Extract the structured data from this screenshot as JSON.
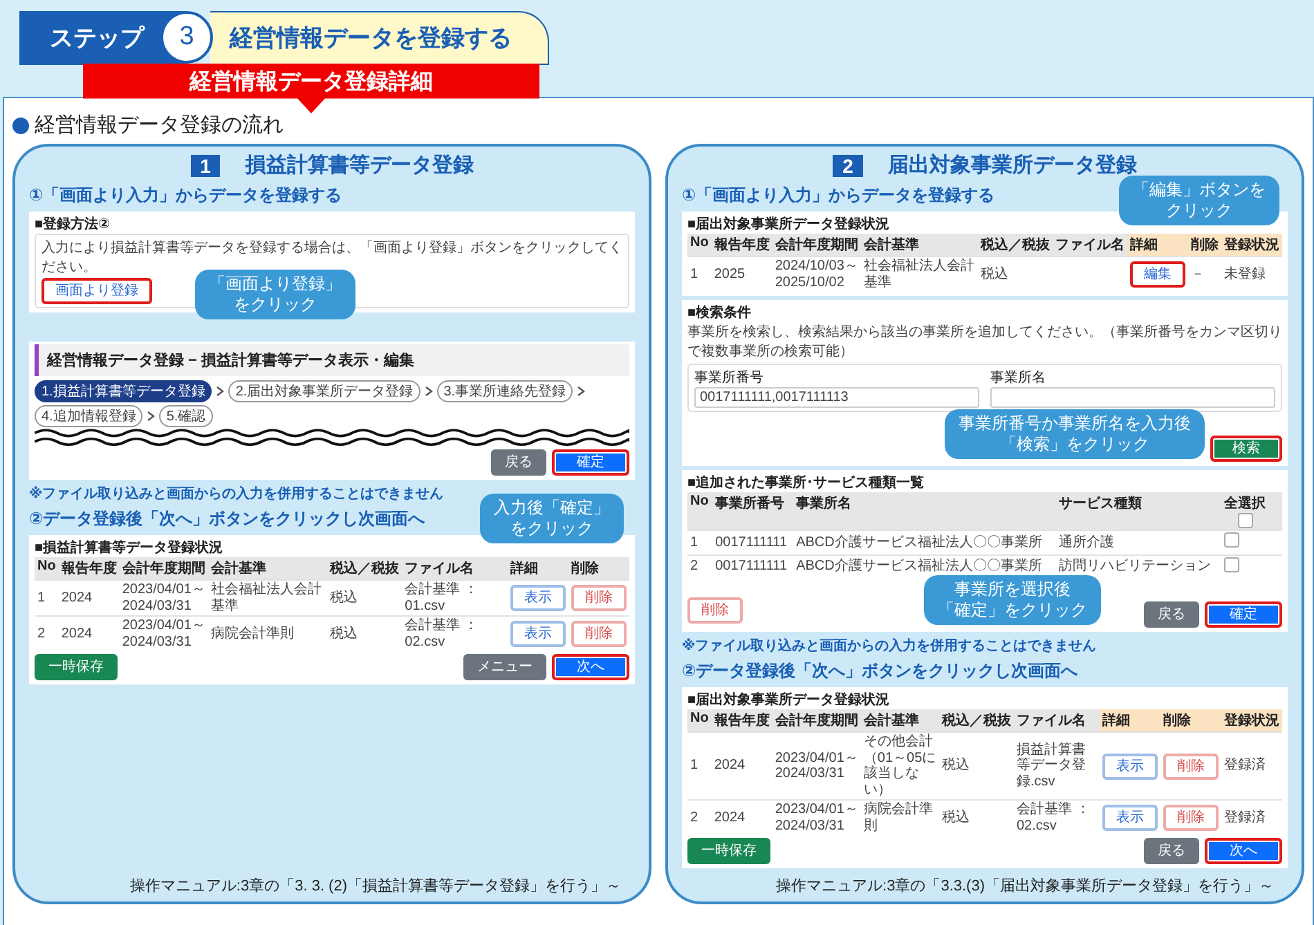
{
  "header": {
    "step_label": "ステップ",
    "step_number": "3",
    "step_title": "経営情報データを登録する",
    "banner": "経営情報データ登録詳細"
  },
  "section_title": "経営情報データ登録の流れ",
  "panels": [
    {
      "number": "1",
      "title": "損益計算書等データ登録",
      "step1_heading": "①「画面より入力」からデータを登録する",
      "blocks": [
        {
          "kind": "method",
          "caption": "■登録方法②",
          "text": "入力により損益計算書等データを登録する場合は、「画面より登録」ボタンをクリックしてください。",
          "button": {
            "label": "画面より登録",
            "kind": "outline",
            "highlight": true
          },
          "callout": [
            "「画面より登録」",
            "をクリック"
          ]
        },
        {
          "kind": "edit_screen",
          "title": "経営情報データ登録 − 損益計算書等データ表示・編集",
          "steps": [
            {
              "label": "1.損益計算書等データ登録",
              "selected": true
            },
            {
              "label": "2.届出対象事業所データ登録",
              "selected": false
            },
            {
              "label": "3.事業所連絡先登録",
              "selected": false
            },
            {
              "label": "4.追加情報登録",
              "selected": false
            },
            {
              "label": "5.確認",
              "selected": false
            }
          ],
          "actions": [
            {
              "label": "戻る",
              "kind": "back",
              "highlight": false
            },
            {
              "label": "確定",
              "kind": "primary",
              "highlight": true
            }
          ],
          "callout": [
            "入力後「確定」",
            "をクリック"
          ]
        }
      ],
      "note": "※ファイル取り込みと画面からの入力を併用することはできません",
      "step2_heading": "②データ登録後「次へ」ボタンをクリックし次画面へ",
      "table": {
        "caption": "■損益計算書等データ登録状況",
        "columns": [
          {
            "label": "No",
            "tinted": false
          },
          {
            "label": "報告年度",
            "tinted": false
          },
          {
            "label": "会計年度期間",
            "tinted": false
          },
          {
            "label": "会計基準",
            "tinted": false
          },
          {
            "label": "税込／税抜",
            "tinted": false
          },
          {
            "label": "ファイル名",
            "tinted": false
          },
          {
            "label": "詳細",
            "tinted": false
          },
          {
            "label": "削除",
            "tinted": false
          }
        ],
        "rows": [
          {
            "cells": [
              "1",
              "2024",
              "2023/04/01～\n2024/03/31",
              "社会福祉法人会計基準",
              "税込",
              "会計基準 ：01.csv",
              {
                "label": "表示",
                "kind": "view",
                "highlight": false
              },
              {
                "label": "削除",
                "kind": "danger",
                "highlight": false
              }
            ]
          },
          {
            "cells": [
              "2",
              "2024",
              "2023/04/01～\n2024/03/31",
              "病院会計準則",
              "税込",
              "会計基準 ：02.csv",
              {
                "label": "表示",
                "kind": "view",
                "highlight": false
              },
              {
                "label": "削除",
                "kind": "danger",
                "highlight": false
              }
            ]
          }
        ],
        "actions": [
          {
            "label": "一時保存",
            "kind": "save",
            "highlight": false
          },
          {
            "label": "メニュー",
            "kind": "back",
            "highlight": false
          },
          {
            "label": "次へ",
            "kind": "primary",
            "highlight": true
          }
        ]
      },
      "manual_ref": "操作マニュアル:3章の「3. 3. (2)「損益計算書等データ登録」を行う」～"
    },
    {
      "number": "2",
      "title": "届出対象事業所データ登録",
      "step1_heading": "①「画面より入力」からデータを登録する",
      "blocks": [
        {
          "kind": "status_table",
          "caption": "■届出対象事業所データ登録状況",
          "columns": [
            {
              "label": "No",
              "tinted": false
            },
            {
              "label": "報告年度",
              "tinted": false
            },
            {
              "label": "会計年度期間",
              "tinted": false
            },
            {
              "label": "会計基準",
              "tinted": false
            },
            {
              "label": "税込／税抜",
              "tinted": false
            },
            {
              "label": "ファイル名",
              "tinted": false
            },
            {
              "label": "詳細",
              "tinted": true
            },
            {
              "label": "削除",
              "tinted": true
            },
            {
              "label": "登録状況",
              "tinted": true
            }
          ],
          "rows": [
            {
              "cells": [
                "1",
                "2025",
                "2024/10/03～\n2025/10/02",
                "社会福祉法人会計基準",
                "税込",
                null,
                {
                  "label": "編集",
                  "kind": "edit",
                  "highlight": true
                },
                "－",
                "未登録"
              ]
            }
          ],
          "callout": [
            "「編集」ボタンを",
            "クリック"
          ]
        },
        {
          "kind": "search",
          "caption": "■検索条件",
          "text": "事業所を検索し、検索結果から該当の事業所を追加してください。（事業所番号をカンマ区切りで複数事業所の検索可能）",
          "fields": [
            {
              "label": "事業所番号",
              "value": "0017111111,0017111113"
            },
            {
              "label": "事業所名"
            }
          ],
          "button": {
            "label": "検索",
            "kind": "search",
            "highlight": true
          },
          "callout": [
            "事業所番号か事業所名を入力後",
            "「検索」をクリック"
          ]
        },
        {
          "kind": "added_list",
          "caption": "■追加された事業所･サービス種類一覧",
          "columns": [
            "No",
            "事業所番号",
            "事業所名",
            "サービス種類",
            "全選択"
          ],
          "select_all_checked": false,
          "rows": [
            {
              "cells": [
                "1",
                "0017111111",
                "ABCD介護サービス福祉法人〇〇事業所",
                "通所介護"
              ],
              "checked": false
            },
            {
              "cells": [
                "2",
                "0017111111",
                "ABCD介護サービス福祉法人〇〇事業所",
                "訪問リハビリテーション"
              ],
              "checked": false
            }
          ],
          "delete_button": {
            "label": "削除",
            "kind": "danger",
            "highlight": false
          },
          "actions": [
            {
              "label": "戻る",
              "kind": "back",
              "highlight": false
            },
            {
              "label": "確定",
              "kind": "primary",
              "highlight": true
            }
          ],
          "callout": [
            "事業所を選択後",
            "「確定」をクリック"
          ]
        }
      ],
      "note": "※ファイル取り込みと画面からの入力を併用することはできません",
      "step2_heading": "②データ登録後「次へ」ボタンをクリックし次画面へ",
      "table": {
        "caption": "■届出対象事業所データ登録状況",
        "columns": [
          {
            "label": "No",
            "tinted": false
          },
          {
            "label": "報告年度",
            "tinted": false
          },
          {
            "label": "会計年度期間",
            "tinted": false
          },
          {
            "label": "会計基準",
            "tinted": false
          },
          {
            "label": "税込／税抜",
            "tinted": false
          },
          {
            "label": "ファイル名",
            "tinted": false
          },
          {
            "label": "詳細",
            "tinted": true
          },
          {
            "label": "削除",
            "tinted": true
          },
          {
            "label": "登録状況",
            "tinted": true
          }
        ],
        "rows": [
          {
            "cells": [
              "1",
              "2024",
              "2023/04/01～\n2024/03/31",
              "その他会計（01～05に該当しない）",
              "税込",
              "損益計算書等データ登録.csv",
              {
                "label": "表示",
                "kind": "view",
                "highlight": false
              },
              {
                "label": "削除",
                "kind": "danger",
                "highlight": false
              },
              "登録済"
            ]
          },
          {
            "cells": [
              "2",
              "2024",
              "2023/04/01～\n2024/03/31",
              "病院会計準則",
              "税込",
              "会計基準 ：02.csv",
              {
                "label": "表示",
                "kind": "view",
                "highlight": false
              },
              {
                "label": "削除",
                "kind": "danger",
                "highlight": false
              },
              "登録済"
            ]
          }
        ],
        "actions": [
          {
            "label": "一時保存",
            "kind": "save",
            "highlight": false
          },
          {
            "label": "戻る",
            "kind": "back",
            "highlight": false
          },
          {
            "label": "次へ",
            "kind": "primary",
            "highlight": true
          }
        ]
      },
      "manual_ref": "操作マニュアル:3章の「3.3.(3)「届出対象事業所データ登録」を行う」～"
    }
  ]
}
